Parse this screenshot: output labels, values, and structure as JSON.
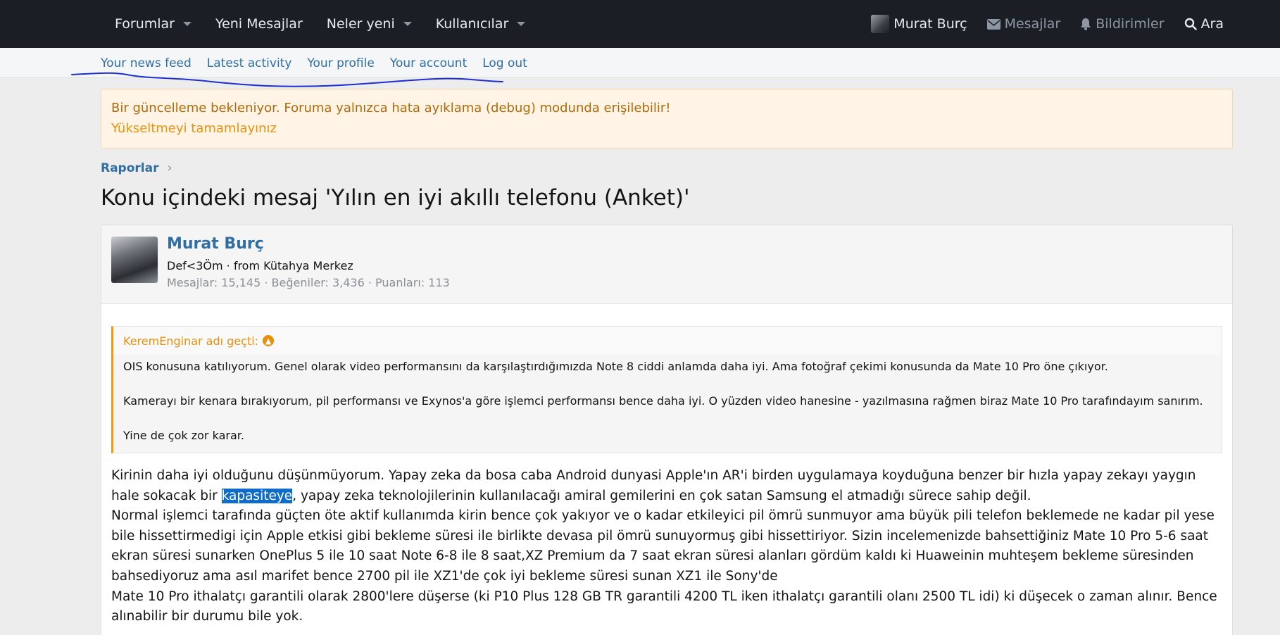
{
  "nav": {
    "left": [
      {
        "label": "Forumlar",
        "dropdown": true
      },
      {
        "label": "Yeni Mesajlar",
        "dropdown": false
      },
      {
        "label": "Neler yeni",
        "dropdown": true
      },
      {
        "label": "Kullanıcılar",
        "dropdown": true
      }
    ],
    "user_label": "Murat Burç",
    "messages_label": "Mesajlar",
    "alerts_label": "Bildirimler",
    "search_label": "Ara"
  },
  "subnav": [
    "Your news feed",
    "Latest activity",
    "Your profile",
    "Your account",
    "Log out"
  ],
  "notice": {
    "line1": "Bir güncelleme bekleniyor. Foruma yalnızca hata ayıklama (debug) modunda erişilebilir!",
    "link": "Yükseltmeyi tamamlayınız"
  },
  "breadcrumb": "Raporlar",
  "page_title": "Konu içindeki mesaj 'Yılın en iyi akıllı telefonu (Anket)'",
  "author": {
    "name": "Murat Burç",
    "title": "Def<3Öm · from Kütahya Merkez",
    "stats": "Mesajlar: 15,145 · Beğeniler: 3,436 · Puanları: 113"
  },
  "quote": {
    "header": "KeremEnginar adı geçti:",
    "paragraphs": [
      "OIS konusuna katılıyorum. Genel olarak video performansını da karşılaştırdığımızda Note 8 ciddi anlamda daha iyi. Ama fotoğraf çekimi konusunda da Mate 10 Pro öne çıkıyor.",
      "Kamerayı bir kenara bırakıyorum, pil performansı ve Exynos'a göre işlemci performansı bence daha iyi. O yüzden video hanesine - yazılmasına rağmen biraz Mate 10 Pro tarafındayım sanırım.",
      "Yine de çok zor karar."
    ]
  },
  "body": {
    "p1_before": "Kirinin daha iyi olduğunu düşünmüyorum. Yapay zeka da bosa caba Android dunyasi Apple'ın AR'i birden uygulamaya koyduğuna benzer bir hızla yapay zekayı yaygın hale sokacak bir ",
    "p1_highlight": "kapasiteye",
    "p1_after": ", yapay zeka teknolojilerinin kullanılacağı amiral gemilerini en çok satan Samsung el atmadığı sürece sahip değil.",
    "p2": "Normal işlemci tarafında güçten öte aktif kullanımda kirin bence çok yakıyor ve o kadar etkileyici pil ömrü sunmuyor ama büyük pili telefon beklemede ne kadar pil yese bile hissettirmedigi için Apple etkisi gibi bekleme süresi ile birlikte devasa pil ömrü sunuyormuş gibi hissettiriyor. Sizin incelemenizde bahsettiğiniz Mate 10 Pro 5-6 saat ekran süresi sunarken OnePlus 5 ile 10 saat Note 6-8 ile 8 saat,XZ Premium da 7 saat ekran süresi alanları gördüm kaldı ki Huaweinin muhteşem bekleme süresinden bahsediyoruz ama asıl marifet bence 2700 pil ile XZ1'de çok iyi bekleme süresi sunan XZ1 ile Sony'de",
    "p3": "Mate 10 Pro ithalatçı garantili olarak 2800'lere düşerse (ki P10 Plus 128 GB TR garantili 4200 TL iken ithalatçı garantili olanı 2500 TL idi) ki düşecek o zaman alınır. Bence alınabilir bir durumu bile yok."
  }
}
